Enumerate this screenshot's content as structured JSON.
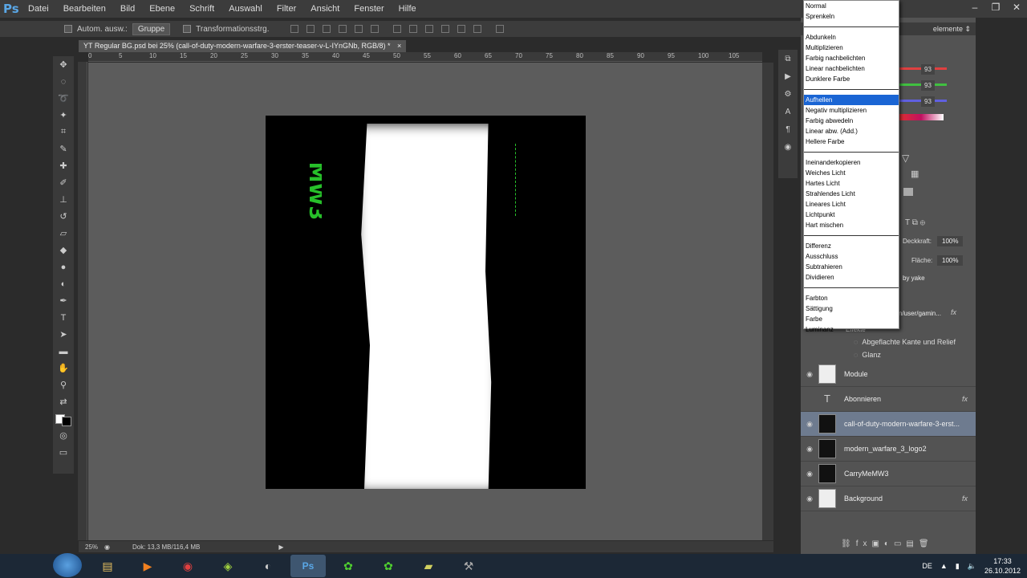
{
  "app": {
    "logo": "Ps"
  },
  "menu": [
    "Datei",
    "Bearbeiten",
    "Bild",
    "Ebene",
    "Schrift",
    "Auswahl",
    "Filter",
    "Ansicht",
    "Fenster",
    "Hilfe"
  ],
  "window_controls": [
    "–",
    "❐",
    "✕"
  ],
  "options_bar": {
    "auto_select_label": "Autom. ausw.:",
    "group_value": "Gruppe",
    "transform_label": "Transformationsstrg."
  },
  "document_tab": {
    "title": "YT Regular BG.psd bei 25% (call-of-duty-modern-warfare-3-erster-teaser-v-L-IYnGNb, RGB/8) *",
    "close": "×"
  },
  "ruler_h_ticks": [
    "0",
    "5",
    "10",
    "15",
    "20",
    "25",
    "30",
    "35",
    "40",
    "45",
    "50",
    "55",
    "60",
    "65",
    "70",
    "75",
    "80",
    "85",
    "90",
    "95",
    "100",
    "105"
  ],
  "status": {
    "zoom": "25%",
    "doc": "Dok: 13,3 MB/116,4 MB"
  },
  "canvas_text": {
    "logo": "MW3"
  },
  "panel": {
    "dropdown_right": "elemente",
    "color_values": [
      "93",
      "93",
      "93"
    ],
    "opacity_label": "Deckkraft:",
    "opacity_value": "100%",
    "fill_label": "Fläche:",
    "fill_value": "100%",
    "partial_layer_1": "by yake",
    "partial_layer_2": "n/user/gamin...",
    "effects_label": "Effekte",
    "effects": [
      "Abgeflachte Kante und Relief",
      "Glanz"
    ]
  },
  "layers": [
    {
      "name": "Module",
      "thumb": "white",
      "fx": ""
    },
    {
      "name": "Abonnieren",
      "thumb": "text",
      "fx": "fx"
    },
    {
      "name": "call-of-duty-modern-warfare-3-erst...",
      "thumb": "image",
      "fx": "",
      "selected": true
    },
    {
      "name": "modern_warfare_3_logo2",
      "thumb": "image",
      "fx": ""
    },
    {
      "name": "CarryMeMW3",
      "thumb": "smart",
      "fx": ""
    },
    {
      "name": "Background",
      "thumb": "white",
      "fx": "fx"
    }
  ],
  "blend_modes": [
    [
      "Normal",
      "Sprenkeln"
    ],
    [
      "Abdunkeln",
      "Multiplizieren",
      "Farbig nachbelichten",
      "Linear nachbelichten",
      "Dunklere Farbe"
    ],
    [
      "Aufhellen",
      "Negativ multiplizieren",
      "Farbig abwedeln",
      "Linear abw. (Add.)",
      "Hellere Farbe"
    ],
    [
      "Ineinanderkopieren",
      "Weiches Licht",
      "Hartes Licht",
      "Strahlendes Licht",
      "Lineares Licht",
      "Lichtpunkt",
      "Hart mischen"
    ],
    [
      "Differenz",
      "Ausschluss",
      "Subtrahieren",
      "Dividieren"
    ],
    [
      "Farbton",
      "Sättigung",
      "Farbe",
      "Luminanz"
    ]
  ],
  "blend_highlight": "Aufhellen",
  "taskbar": {
    "lang": "DE",
    "time": "17:33",
    "date": "26.10.2012"
  },
  "colors": {
    "accent": "#1a65d4",
    "logo_green": "#27c02a",
    "selected_layer": "#6e7b8f"
  }
}
